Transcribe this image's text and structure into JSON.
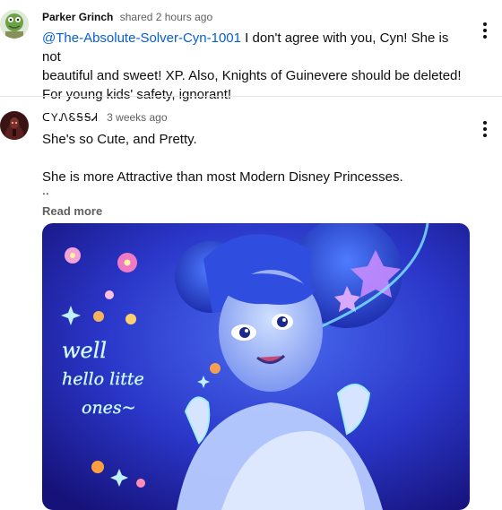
{
  "comments": [
    {
      "author": "Parker Grinch",
      "meta": "shared 2 hours ago",
      "mention": "@The-Absolute-Solver-Cyn-1001",
      "text_line1_rest": " I don't agree with you, Cyn! She is not",
      "text_line2": "beautiful and sweet! XP. Also, Knights of Guinevere should be deleted!",
      "text_line3": "For young kids' safety, ignorant!"
    },
    {
      "author": "ᑕYᏁᏋᎦᎦᏗ",
      "meta": "3 weeks ago",
      "text_line1": "She's so Cute, and Pretty.",
      "text_line2": "She is more Attractive than most Modern Disney Princesses.",
      "ellipsis": "..",
      "read_more": "Read more",
      "art_text": [
        "well",
        "hello litte",
        "ones~"
      ]
    }
  ],
  "icons": {
    "kebab": "more-vert-icon"
  },
  "colors": {
    "mention": "#065fd4",
    "meta": "#606060",
    "artwork_bg": "#1e2fb0"
  }
}
